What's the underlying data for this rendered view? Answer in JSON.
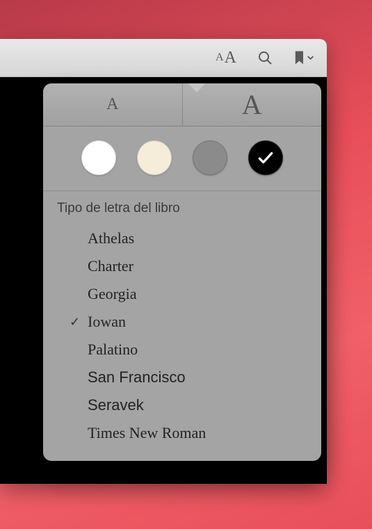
{
  "toolbar": {
    "appearance_small_glyph": "A",
    "appearance_large_glyph": "A"
  },
  "popover": {
    "size_small_glyph": "A",
    "size_large_glyph": "A",
    "themes": {
      "white": "#ffffff",
      "sepia": "#f5ecd9",
      "gray": "#8b8b8b",
      "black": "#000000",
      "selected": "black",
      "check_glyph": "✓"
    },
    "section_title": "Tipo de letra del libro",
    "tick_glyph": "✓",
    "fonts": [
      {
        "name": "Athelas",
        "selected": false,
        "class": "f-athelas"
      },
      {
        "name": "Charter",
        "selected": false,
        "class": "f-charter"
      },
      {
        "name": "Georgia",
        "selected": false,
        "class": "f-georgia"
      },
      {
        "name": "Iowan",
        "selected": true,
        "class": "f-iowan"
      },
      {
        "name": "Palatino",
        "selected": false,
        "class": "f-palatino"
      },
      {
        "name": "San Francisco",
        "selected": false,
        "class": "f-sf"
      },
      {
        "name": "Seravek",
        "selected": false,
        "class": "f-seravek"
      },
      {
        "name": "Times New Roman",
        "selected": false,
        "class": "f-times"
      }
    ]
  }
}
